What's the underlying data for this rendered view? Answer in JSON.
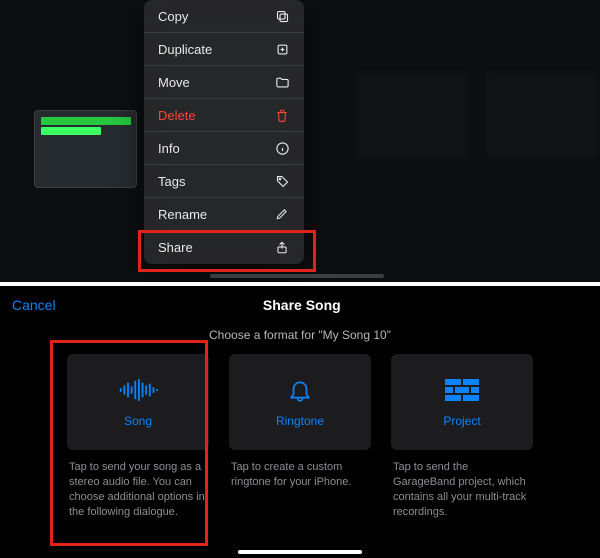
{
  "context_menu": {
    "items": [
      {
        "label": "Copy",
        "icon": "copy-icon",
        "danger": false
      },
      {
        "label": "Duplicate",
        "icon": "duplicate-icon",
        "danger": false
      },
      {
        "label": "Move",
        "icon": "folder-icon",
        "danger": false
      },
      {
        "label": "Delete",
        "icon": "trash-icon",
        "danger": true
      },
      {
        "label": "Info",
        "icon": "info-icon",
        "danger": false
      },
      {
        "label": "Tags",
        "icon": "tag-icon",
        "danger": false
      },
      {
        "label": "Rename",
        "icon": "pencil-icon",
        "danger": false
      },
      {
        "label": "Share",
        "icon": "share-icon",
        "danger": false
      }
    ],
    "highlighted_index": 7
  },
  "share_sheet": {
    "cancel_label": "Cancel",
    "title": "Share Song",
    "subtitle": "Choose a format for \"My Song 10\"",
    "options": [
      {
        "name": "Song",
        "icon": "waveform-icon",
        "desc": "Tap to send your song as a stereo audio file. You can choose additional options in the following dialogue."
      },
      {
        "name": "Ringtone",
        "icon": "bell-icon",
        "desc": "Tap to create a custom ringtone for your iPhone."
      },
      {
        "name": "Project",
        "icon": "bricks-icon",
        "desc": "Tap to send the GarageBand project, which contains all your multi-track recordings."
      }
    ],
    "highlighted_index": 0
  },
  "colors": {
    "accent": "#0a84ff",
    "danger": "#ff453a",
    "highlight_box": "#e2231a"
  }
}
